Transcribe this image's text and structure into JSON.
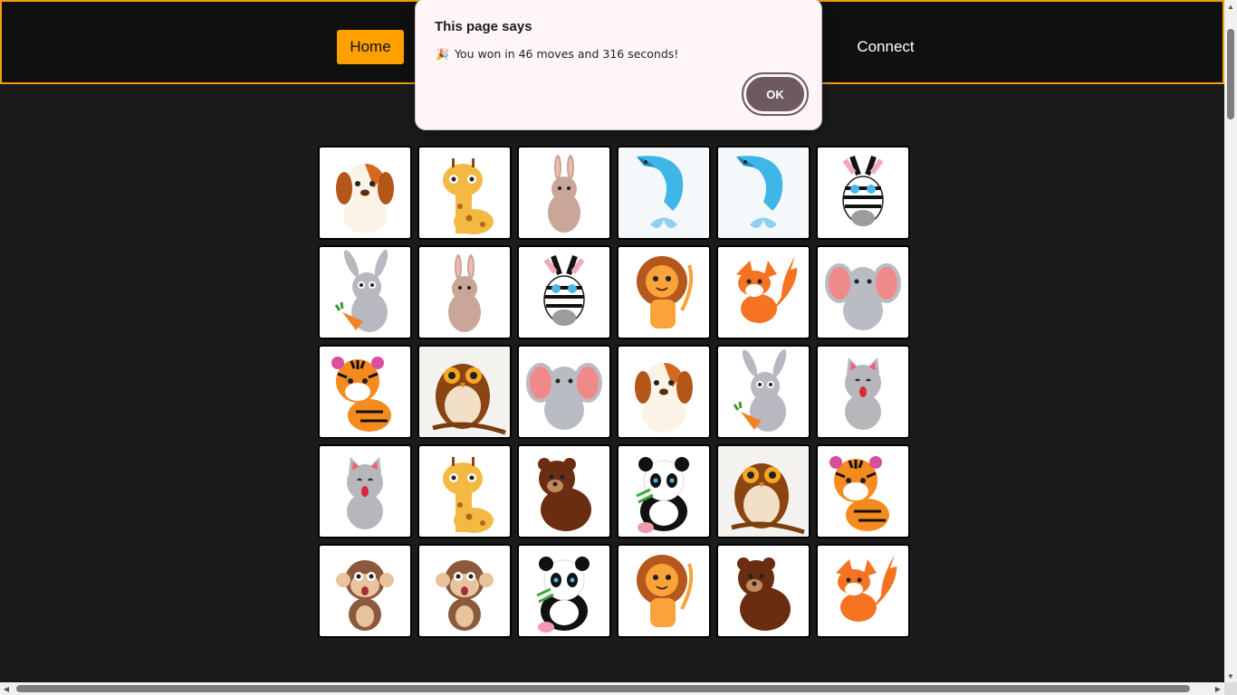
{
  "nav": {
    "home_label": "Home",
    "connect_label": "Connect"
  },
  "dialog": {
    "title": "This page says",
    "icon": "party-popper-icon",
    "message": "You won in 46 moves and 316 seconds!",
    "ok_label": "OK"
  },
  "board": {
    "columns": 6,
    "cards": [
      "dog",
      "giraffe",
      "rabbit",
      "dolphin",
      "dolphin",
      "zebra",
      "bunny-carrot",
      "rabbit",
      "zebra",
      "lion",
      "fox",
      "elephant",
      "tiger",
      "owl",
      "elephant",
      "dog",
      "bunny-carrot",
      "cat",
      "cat",
      "giraffe",
      "bear",
      "panda",
      "owl",
      "tiger",
      "monkey",
      "monkey",
      "panda",
      "lion",
      "bear",
      "fox"
    ]
  },
  "colors": {
    "accent": "#ffa000",
    "navbar_border": "#f39c12",
    "background": "#1b1b1b",
    "ok_button": "#6e5a5e"
  }
}
